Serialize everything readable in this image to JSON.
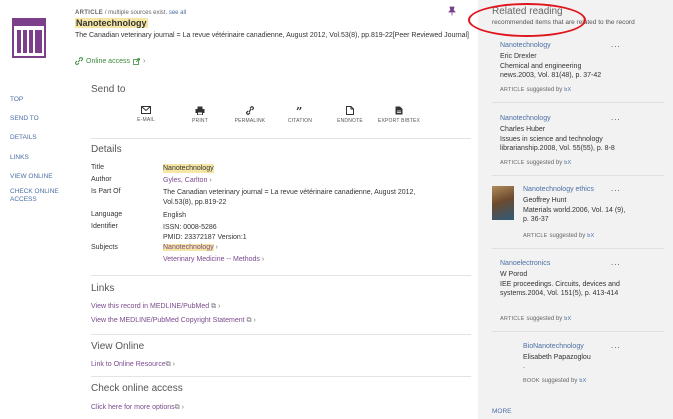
{
  "header": {
    "type_label": "ARTICLE",
    "multiple_sources": "/ multiple sources exist.",
    "see_all": "see all",
    "title": "Nanotechnology",
    "source": "The Canadian veterinary journal = La revue vétérinaire canadienne, August 2012, Vol.53(8), pp.819-22[Peer Reviewed Journal]",
    "online_access": "Online access"
  },
  "left_nav": [
    "TOP",
    "SEND TO",
    "DETAILS",
    "LINKS",
    "VIEW ONLINE",
    "CHECK ONLINE ACCESS"
  ],
  "send_to": {
    "heading": "Send to",
    "items": [
      {
        "label": "E-MAIL",
        "icon": "mail-icon"
      },
      {
        "label": "PRINT",
        "icon": "print-icon"
      },
      {
        "label": "PERMALINK",
        "icon": "link-icon"
      },
      {
        "label": "CITATION",
        "icon": "quote-icon"
      },
      {
        "label": "ENDNOTE",
        "icon": "file-icon"
      },
      {
        "label": "EXPORT BIBTEX",
        "icon": "file-export-icon"
      }
    ]
  },
  "details": {
    "heading": "Details",
    "title_label": "Title",
    "title_value": "Nanotechnology",
    "author_label": "Author",
    "author_value": "Gyles, Carlton",
    "ispartof_label": "Is Part Of",
    "ispartof_line1": "The Canadian veterinary journal = La revue vétérinaire canadienne, August 2012,",
    "ispartof_line2": "Vol.53(8), pp.819-22",
    "language_label": "Language",
    "language_value": "English",
    "identifier_label": "Identifier",
    "identifier_issn": "ISSN: 0008-5286",
    "identifier_pmid": "PMID: 23372187 Version:1",
    "subjects_label": "Subjects",
    "subject_1": "Nanotechnology",
    "subject_2": "Veterinary Medicine -- Methods"
  },
  "links": {
    "heading": "Links",
    "item_1": "View this record in MEDLINE/PubMed",
    "item_2": "View the MEDLINE/PubMed Copyright Statement"
  },
  "view_online": {
    "heading": "View Online",
    "link": "Link to Online Resource"
  },
  "check_online": {
    "heading": "Check online access",
    "link": "Click here for more options"
  },
  "related": {
    "heading": "Related reading",
    "subheading": "recommended items that are related to the record",
    "suggested_by": "suggested by",
    "items": [
      {
        "title": "Nanotechnology",
        "author": "Eric Drexler",
        "citation": "Chemical and engineering news.2003, Vol. 81(48), p. 37-42",
        "type": "ARTICLE"
      },
      {
        "title": "Nanotechnology",
        "author": "Charles Huber",
        "citation": "Issues in science and technology librarianship.2008, Vol. 55(55), p. 8-8",
        "type": "ARTICLE"
      },
      {
        "title": "Nanotechnology ethics",
        "author": "Geoffrey Hunt",
        "citation": "Materials world.2006, Vol. 14 (9), p. 36-37",
        "type": "ARTICLE"
      },
      {
        "title": "Nanoelectronics",
        "author": "W Porod",
        "citation": "IEE proceedings. Circuits, devices and systems.2004, Vol. 151(5), p. 413-414",
        "type": "ARTICLE"
      },
      {
        "title": "BioNanotechnology",
        "author": "Elisabeth Papazoglou",
        "citation": ".",
        "type": "BOOK"
      }
    ],
    "more": "MORE"
  }
}
